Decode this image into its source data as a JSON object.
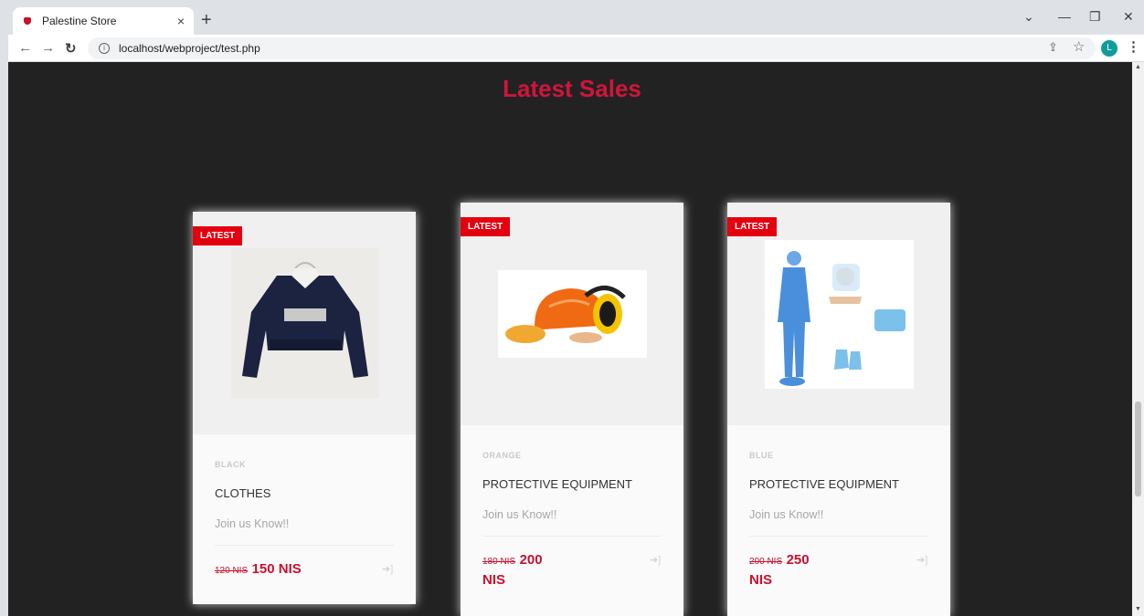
{
  "browser": {
    "tab_title": "Palestine Store",
    "tab_close": "×",
    "new_tab": "+",
    "url": "localhost/webproject/test.php",
    "profile_initial": "L"
  },
  "page": {
    "section_title": "Latest Sales"
  },
  "products": [
    {
      "badge": "LATEST",
      "color": "BLACK",
      "name": "CLOTHES",
      "promo": "Join us Know!!",
      "old_price": "120 NIS",
      "new_price": "150 NIS",
      "image_icon": "sweater-image"
    },
    {
      "badge": "LATEST",
      "color": "ORANGE",
      "name": "PROTECTIVE EQUIPMENT",
      "promo": "Join us Know!!",
      "old_price": "180 NIS",
      "new_price": "200 NIS",
      "image_icon": "safety-helmet-image"
    },
    {
      "badge": "LATEST",
      "color": "BLUE",
      "name": "PROTECTIVE EQUIPMENT",
      "promo": "Join us Know!!",
      "old_price": "200 NIS",
      "new_price": "250 NIS",
      "image_icon": "ppe-suit-image"
    }
  ],
  "colors": {
    "page_bg": "#222222",
    "accent": "#d0153b",
    "badge": "#e3000f"
  }
}
